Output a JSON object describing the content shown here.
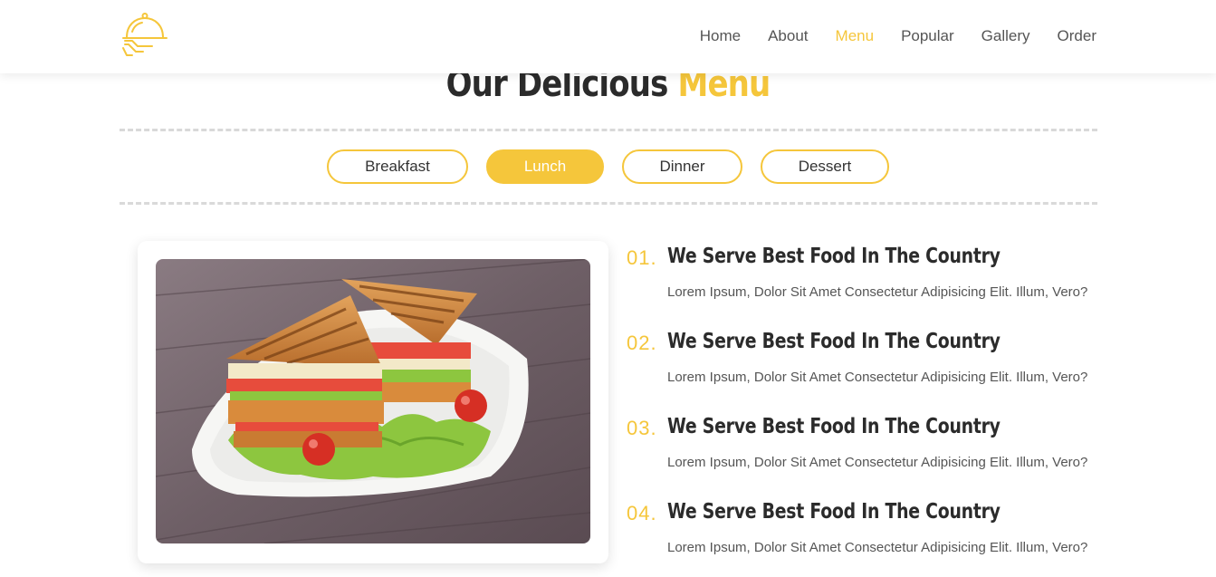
{
  "colors": {
    "accent": "#f5c63b",
    "text_dark": "#2b2b2b",
    "text_muted": "#555555"
  },
  "header": {
    "logo_icon": "serving-cloche-icon",
    "nav": [
      {
        "label": "Home",
        "active": false
      },
      {
        "label": "About",
        "active": false
      },
      {
        "label": "Menu",
        "active": true
      },
      {
        "label": "Popular",
        "active": false
      },
      {
        "label": "Gallery",
        "active": false
      },
      {
        "label": "Order",
        "active": false
      }
    ]
  },
  "section": {
    "title_main": "Our Delicious",
    "title_accent": "Menu",
    "tabs": [
      {
        "label": "Breakfast",
        "active": false
      },
      {
        "label": "Lunch",
        "active": true
      },
      {
        "label": "Dinner",
        "active": false
      },
      {
        "label": "Dessert",
        "active": false
      }
    ],
    "image_icon": "club-sandwich-photo",
    "items": [
      {
        "num": "01.",
        "title": "We Serve Best Food In The Country",
        "desc": "Lorem Ipsum, Dolor Sit Amet Consectetur Adipisicing Elit. Illum, Vero?"
      },
      {
        "num": "02.",
        "title": "We Serve Best Food In The Country",
        "desc": "Lorem Ipsum, Dolor Sit Amet Consectetur Adipisicing Elit. Illum, Vero?"
      },
      {
        "num": "03.",
        "title": "We Serve Best Food In The Country",
        "desc": "Lorem Ipsum, Dolor Sit Amet Consectetur Adipisicing Elit. Illum, Vero?"
      },
      {
        "num": "04.",
        "title": "We Serve Best Food In The Country",
        "desc": "Lorem Ipsum, Dolor Sit Amet Consectetur Adipisicing Elit. Illum, Vero?"
      }
    ]
  }
}
